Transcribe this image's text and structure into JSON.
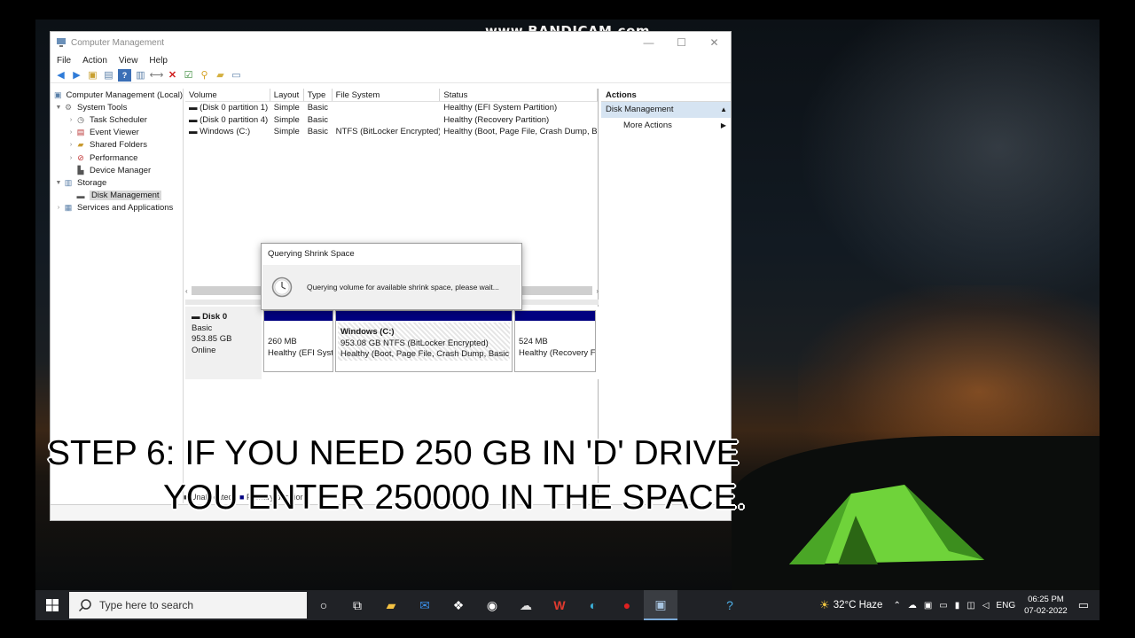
{
  "watermark": "www.BANDICAM.com",
  "window": {
    "title": "Computer Management",
    "controls": [
      "—",
      "☐",
      "✕"
    ],
    "menu": [
      "File",
      "Action",
      "View",
      "Help"
    ]
  },
  "tree": {
    "root": "Computer Management (Local)",
    "system_tools": "System Tools",
    "task_scheduler": "Task Scheduler",
    "event_viewer": "Event Viewer",
    "shared_folders": "Shared Folders",
    "performance": "Performance",
    "device_manager": "Device Manager",
    "storage": "Storage",
    "disk_management": "Disk Management",
    "services": "Services and Applications"
  },
  "volumes": {
    "headers": [
      "Volume",
      "Layout",
      "Type",
      "File System",
      "Status"
    ],
    "rows": [
      [
        "(Disk 0 partition 1)",
        "Simple",
        "Basic",
        "",
        "Healthy (EFI System Partition)"
      ],
      [
        "(Disk 0 partition 4)",
        "Simple",
        "Basic",
        "",
        "Healthy (Recovery Partition)"
      ],
      [
        "Windows (C:)",
        "Simple",
        "Basic",
        "NTFS (BitLocker Encrypted)",
        "Healthy (Boot, Page File, Crash Dump, Bas"
      ]
    ]
  },
  "disk": {
    "name": "Disk 0",
    "type": "Basic",
    "size": "953.85 GB",
    "state": "Online",
    "partitions": [
      {
        "line1": "",
        "line2": "260 MB",
        "line3": "Healthy (EFI Syst"
      },
      {
        "line1": "Windows  (C:)",
        "line2": "953.08 GB NTFS (BitLocker Encrypted)",
        "line3": "Healthy (Boot, Page File, Crash Dump, Basic D"
      },
      {
        "line1": "",
        "line2": "524 MB",
        "line3": "Healthy (Recovery F"
      }
    ]
  },
  "legend": {
    "unallocated": "Unallocated",
    "primary": "Primary partition"
  },
  "actions": {
    "header": "Actions",
    "selected": "Disk Management",
    "more": "More Actions"
  },
  "dialog": {
    "title": "Querying Shrink Space",
    "message": "Querying volume for available shrink space, please wait..."
  },
  "caption": {
    "line1": "STEP 6: IF YOU NEED 250 GB IN 'D' DRIVE",
    "line2": "YOU ENTER 250000 IN THE SPACE."
  },
  "taskbar": {
    "search_placeholder": "Type here to search",
    "weather": "32°C  Haze",
    "lang": "ENG",
    "time": "06:25 PM",
    "date": "07-02-2022"
  },
  "colors": {
    "partition_stripe": "#000080",
    "selection": "#d6e4f2",
    "taskbar": "#202226"
  }
}
